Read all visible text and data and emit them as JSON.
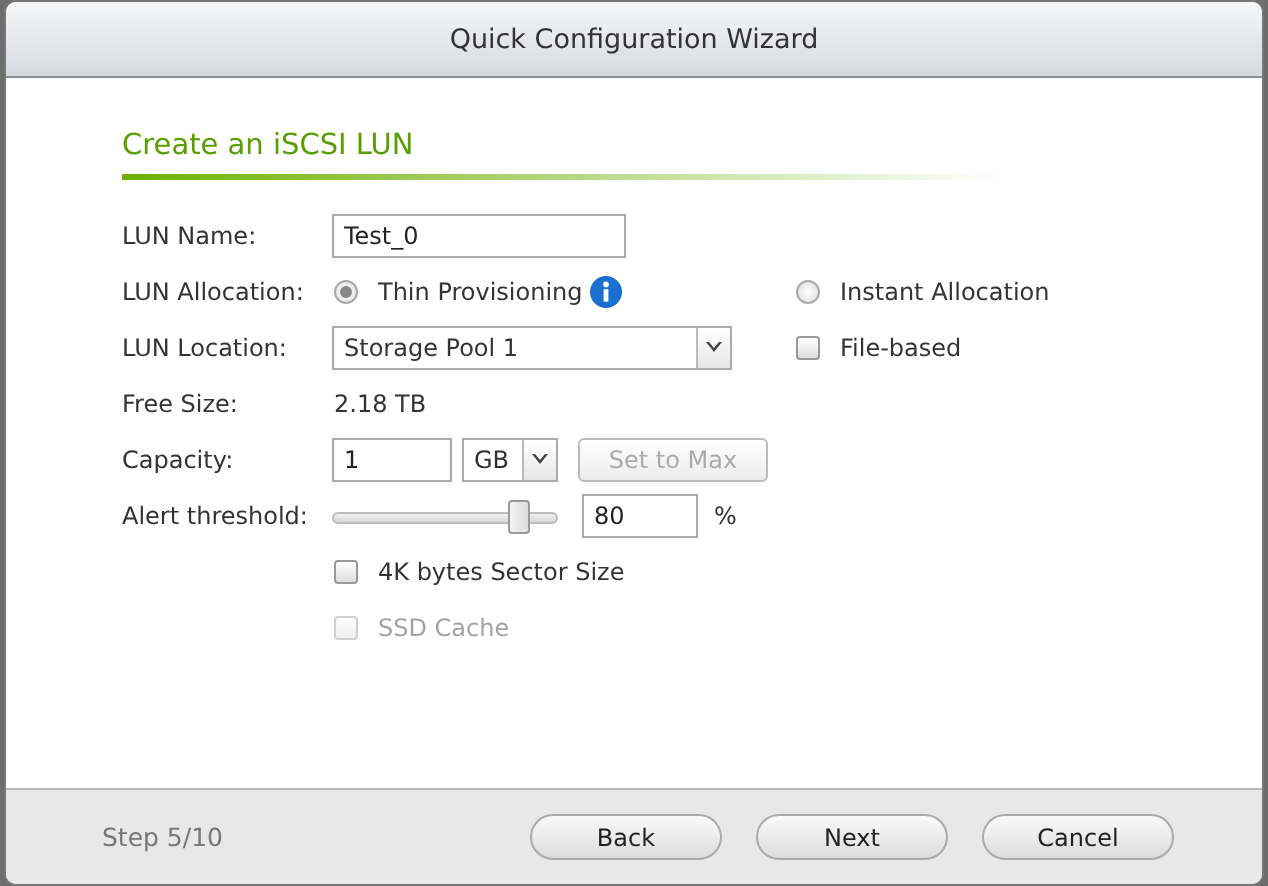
{
  "window": {
    "title": "Quick Configuration Wizard"
  },
  "section": {
    "title": "Create an iSCSI LUN"
  },
  "form": {
    "lun_name": {
      "label": "LUN Name:",
      "value": "Test_0"
    },
    "allocation": {
      "label": "LUN Allocation:",
      "options": [
        {
          "label": "Thin Provisioning",
          "selected": true,
          "info": true
        },
        {
          "label": "Instant Allocation",
          "selected": false,
          "info": false
        }
      ]
    },
    "location": {
      "label": "LUN Location:",
      "value": "Storage Pool 1",
      "file_based": {
        "label": "File-based",
        "checked": false
      }
    },
    "free_size": {
      "label": "Free Size:",
      "value": "2.18 TB"
    },
    "capacity": {
      "label": "Capacity:",
      "value": "1",
      "unit": "GB",
      "button": {
        "label": "Set to Max",
        "disabled": true
      }
    },
    "alert": {
      "label": "Alert threshold:",
      "level": 0.83,
      "value": "80",
      "unit": "%"
    },
    "options": [
      {
        "label": "4K bytes Sector Size",
        "checked": false,
        "disabled": false
      },
      {
        "label": "SSD Cache",
        "checked": false,
        "disabled": true
      }
    ]
  },
  "footer": {
    "step": "Step 5/10",
    "buttons": [
      "Back",
      "Next",
      "Cancel"
    ]
  }
}
